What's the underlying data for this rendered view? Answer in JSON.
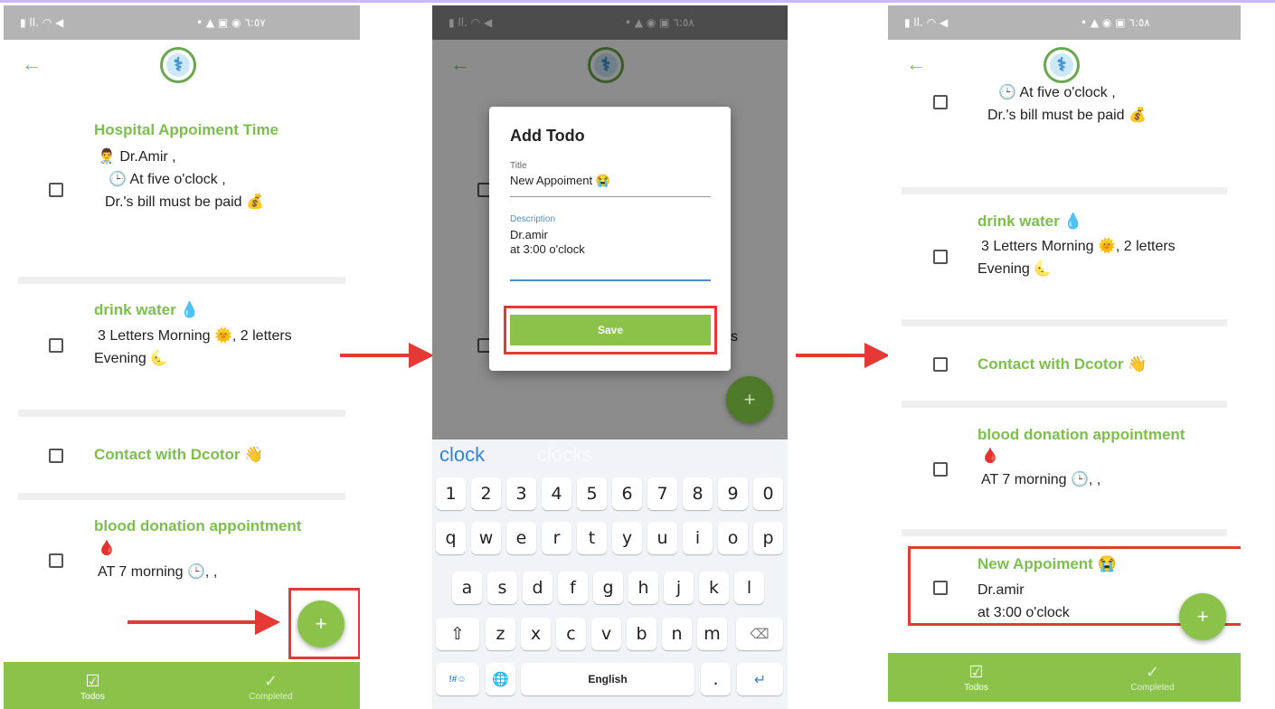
{
  "colors": {
    "accent": "#8bc34a",
    "title_green": "#7cbf4c",
    "highlight_red": "#e53935"
  },
  "phone1": {
    "status": {
      "left": "▮ ll. ◠ ◀",
      "right": "• ▲ ▣ ◉ ٦:٥٧"
    },
    "back_icon": "←",
    "logo": "⚕",
    "todos": [
      {
        "title": "Hospital Appoiment Time",
        "lines": [
          "👨‍⚕️ Dr.Amir ,",
          "🕒 At five o'clock ,",
          "Dr.'s bill must be paid 💰"
        ]
      },
      {
        "title": "drink water 💧",
        "lines": [
          "3 Letters  Morning 🌞, 2 letters",
          "Evening 🌜"
        ]
      },
      {
        "title": "Contact with Dcotor 👋",
        "lines": []
      },
      {
        "title": "blood donation appointment",
        "lines": [
          "🩸",
          "AT 7 morning 🕒, ,"
        ]
      }
    ],
    "fab": "+",
    "nav": [
      {
        "label": "Todos",
        "icon": "☑"
      },
      {
        "label": "Completed",
        "icon": "✓"
      }
    ]
  },
  "phone2": {
    "status": {
      "left": "▮ ll. ◠ ◀",
      "right": "• ▲ ◉ ▣ ٦:٥٨"
    },
    "dialog": {
      "title": "Add Todo",
      "title_label": "Title",
      "title_value": "New Appoiment 😭",
      "description_label": "Description",
      "description_line1": "Dr.amir",
      "description_line2": "at 3:00 o'clock",
      "save_label": "Save"
    },
    "bg_checkbox_suffix": "s",
    "keyboard": {
      "suggestions": [
        "clock",
        "clocks"
      ],
      "row_numbers": [
        "1",
        "2",
        "3",
        "4",
        "5",
        "6",
        "7",
        "8",
        "9",
        "0"
      ],
      "row1": [
        "q",
        "w",
        "e",
        "r",
        "t",
        "y",
        "u",
        "i",
        "o",
        "p"
      ],
      "row2": [
        "a",
        "s",
        "d",
        "f",
        "g",
        "h",
        "j",
        "k",
        "l"
      ],
      "row3": [
        "z",
        "x",
        "c",
        "v",
        "b",
        "n",
        "m"
      ],
      "shift": "⇧",
      "backspace": "⌫",
      "symbols": "!#☺",
      "globe": "🌐",
      "space_label": "English",
      "period": ".",
      "enter": "↵"
    }
  },
  "phone3": {
    "status": {
      "left": "▮ ll. ◠ ◀",
      "right": "• ▲ ◉ ▣ ٦:٥٨"
    },
    "todos": [
      {
        "title": "",
        "lines": [
          "🕒 At five o'clock ,",
          "Dr.'s bill must be paid 💰"
        ]
      },
      {
        "title": "drink water 💧",
        "lines": [
          "3 Letters  Morning 🌞, 2 letters",
          "Evening 🌜"
        ]
      },
      {
        "title": "Contact with Dcotor 👋",
        "lines": []
      },
      {
        "title": "blood donation appointment",
        "lines": [
          "🩸",
          "AT 7 morning 🕒, ,"
        ]
      },
      {
        "title": "New Appoiment 😭",
        "lines": [
          "Dr.amir",
          "at 3:00 o'clock"
        ]
      }
    ],
    "nav": [
      {
        "label": "Todos",
        "icon": "☑"
      },
      {
        "label": "Completed",
        "icon": "✓"
      }
    ]
  }
}
